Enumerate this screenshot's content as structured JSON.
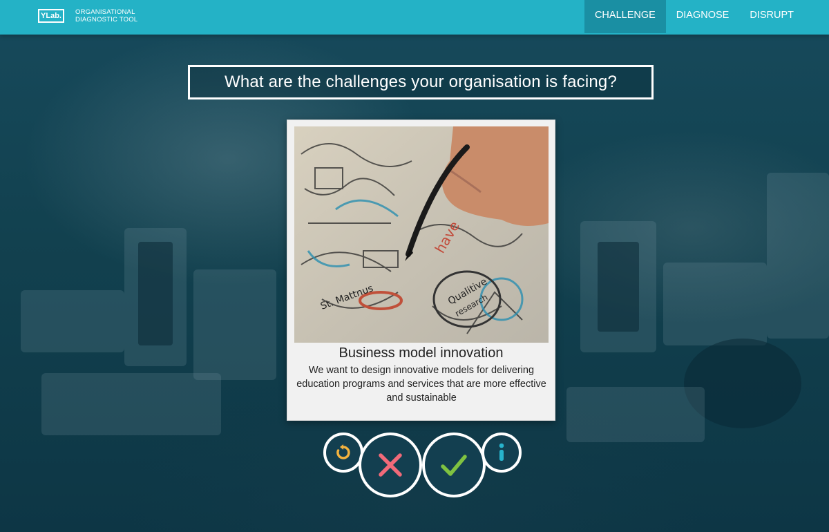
{
  "app": {
    "logo": "YLab.",
    "tagline_line1": "ORGANISATIONAL",
    "tagline_line2": "DIAGNOSTIC TOOL"
  },
  "nav": {
    "items": [
      {
        "label": "CHALLENGE",
        "active": true
      },
      {
        "label": "DIAGNOSE",
        "active": false
      },
      {
        "label": "DISRUPT",
        "active": false
      }
    ]
  },
  "question": "What are the challenges your organisation is facing?",
  "card": {
    "title": "Business model innovation",
    "description": "We want to design innovative models for delivering education programs and services that are more effective and sustainable",
    "image_icon": "sketch-drawing-photo"
  },
  "actions": {
    "undo_icon": "undo-icon",
    "reject_icon": "close-icon",
    "accept_icon": "check-icon",
    "info_icon": "info-icon"
  },
  "colors": {
    "topbar": "#24b2c6",
    "nav_active": "#1a8fa3",
    "undo": "#f3b23e",
    "reject": "#f16a79",
    "accept": "#7fc241",
    "info": "#27b3cc"
  }
}
